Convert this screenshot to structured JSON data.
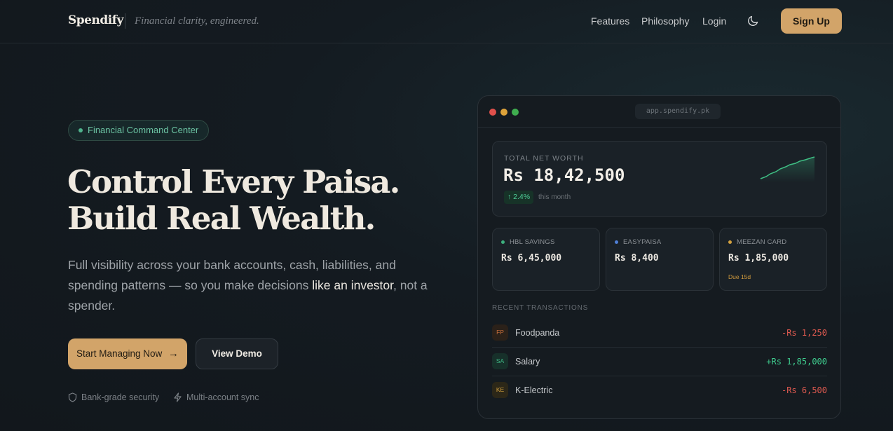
{
  "nav": {
    "logo": "Spendify",
    "tagline": "Financial clarity, engineered.",
    "links": [
      "Features",
      "Philosophy",
      "Login"
    ],
    "theme_icon": "moon-icon",
    "signup": "Sign Up"
  },
  "hero": {
    "badge": "Financial Command Center",
    "title_line1": "Control Every Paisa.",
    "title_line2": "Build Real Wealth.",
    "desc_part1": "Full visibility across your bank accounts, cash, liabilities, and spending patterns — so you make decisions ",
    "desc_em": "like an investor",
    "desc_part2": ", not a spender.",
    "cta_primary": "Start Managing Now",
    "cta_secondary": "View Demo",
    "features": [
      {
        "icon": "shield-icon",
        "label": "Bank-grade security"
      },
      {
        "icon": "lightning-icon",
        "label": "Multi-account sync"
      }
    ]
  },
  "mock": {
    "url": "app.spendify.pk",
    "window_dots": [
      "#e0504b",
      "#dea33a",
      "#3fae4f"
    ],
    "net_worth": {
      "label": "TOTAL NET WORTH",
      "value": "Rs 18,42,500",
      "change": "↑ 2.4%",
      "period": "this month"
    },
    "accounts": [
      {
        "name": "HBL SAVINGS",
        "value": "Rs 6,45,000",
        "dot": "#3db07e",
        "note": ""
      },
      {
        "name": "EASYPAISA",
        "value": "Rs 8,400",
        "dot": "#4f7fd6",
        "note": ""
      },
      {
        "name": "MEEZAN CARD",
        "value": "Rs 1,85,000",
        "dot": "#d3a13f",
        "note": "Due 15d"
      }
    ],
    "tx_heading": "RECENT TRANSACTIONS",
    "transactions": [
      {
        "code": "FP",
        "name": "Foodpanda",
        "amount": "-Rs 1,250",
        "type": "debit"
      },
      {
        "code": "SA",
        "name": "Salary",
        "amount": "+Rs 1,85,000",
        "type": "credit"
      },
      {
        "code": "KE",
        "name": "K-Electric",
        "amount": "-Rs 6,500",
        "type": "debit"
      }
    ]
  },
  "colors": {
    "accent": "#d2a469",
    "positive": "#3fce8f",
    "negative": "#e05a50",
    "background": "#141b21"
  }
}
